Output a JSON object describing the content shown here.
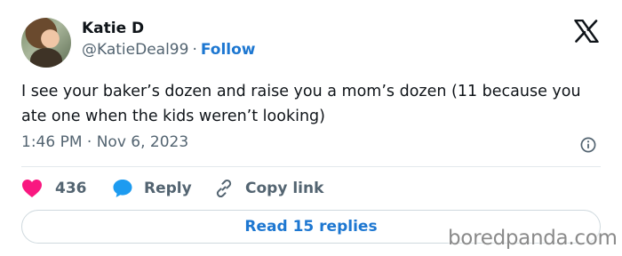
{
  "author": {
    "name": "Katie D",
    "handle": "@KatieDeal99",
    "separator": "·",
    "follow_label": "Follow"
  },
  "tweet": {
    "text": "I see your baker’s dozen and raise you a mom’s dozen (11 because you ate one when the kids weren’t looking)",
    "timestamp": "1:46 PM · Nov 6, 2023"
  },
  "actions": {
    "like_count": "436",
    "reply_label": "Reply",
    "copy_link_label": "Copy link"
  },
  "read_replies_label": "Read 15 replies",
  "watermark": "boredpanda.com",
  "icons": {
    "platform": "x-logo-icon",
    "info": "info-icon",
    "like": "heart-icon",
    "reply": "speech-bubble-icon",
    "copy_link": "link-icon"
  },
  "colors": {
    "accent": "#1d77d1",
    "like": "#f91880",
    "reply": "#1d9bf0",
    "text": "#0f1419",
    "muted": "#536471"
  }
}
